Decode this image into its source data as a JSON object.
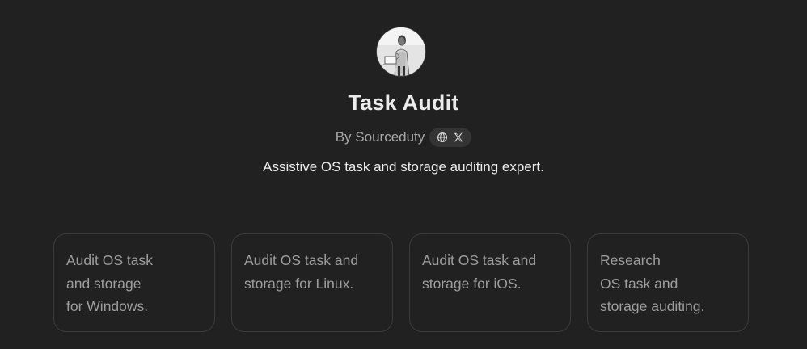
{
  "gpt": {
    "name": "Task Audit",
    "byline": "By Sourceduty",
    "description": "Assistive OS task and storage auditing expert.",
    "social_icons": [
      "globe-icon",
      "x-logo-icon"
    ]
  },
  "starters": [
    {
      "text": "Audit OS task\nand storage\nfor Windows."
    },
    {
      "text": "Audit OS task and\nstorage for Linux."
    },
    {
      "text": "Audit OS task and\nstorage for iOS."
    },
    {
      "text": "Research\nOS task and\nstorage auditing."
    }
  ],
  "colors": {
    "background": "#212121",
    "card_border": "#3c3c3c",
    "primary_text": "#ececec",
    "muted_text": "#a8a8a8"
  }
}
